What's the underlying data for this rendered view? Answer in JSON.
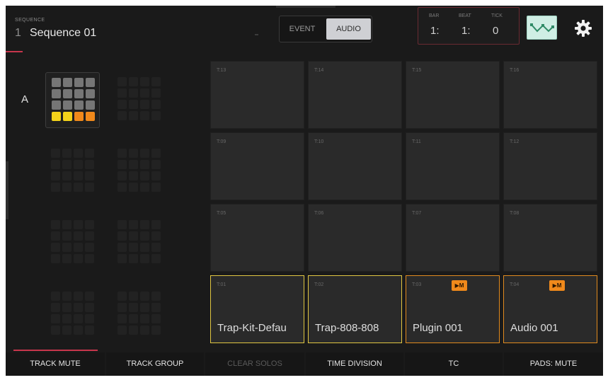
{
  "header": {
    "sequence_label": "SEQUENCE",
    "sequence_number": "1",
    "sequence_name": "Sequence 01",
    "mode_event": "EVENT",
    "mode_audio": "AUDIO",
    "selected_mode": "AUDIO",
    "counter": {
      "bar_label": "BAR",
      "beat_label": "BEAT",
      "tick_label": "TICK",
      "bar_value": "1:",
      "beat_value": "1:",
      "tick_value": "0"
    },
    "automation_icon": "automation-curve-icon",
    "settings_icon": "gear-icon"
  },
  "left_panel": {
    "bank_label": "A",
    "pad_colors": {
      "gray": "#767676",
      "yellow": "#f3d21a",
      "orange": "#f0891b"
    }
  },
  "pads": [
    {
      "num": "T:13",
      "name": ""
    },
    {
      "num": "T:14",
      "name": ""
    },
    {
      "num": "T:15",
      "name": ""
    },
    {
      "num": "T:16",
      "name": ""
    },
    {
      "num": "T:09",
      "name": ""
    },
    {
      "num": "T:10",
      "name": ""
    },
    {
      "num": "T:11",
      "name": ""
    },
    {
      "num": "T:12",
      "name": ""
    },
    {
      "num": "T:05",
      "name": ""
    },
    {
      "num": "T:06",
      "name": ""
    },
    {
      "num": "T:07",
      "name": ""
    },
    {
      "num": "T:08",
      "name": ""
    },
    {
      "num": "T:01",
      "name": "Trap-Kit-Defau"
    },
    {
      "num": "T:02",
      "name": "Trap-808-808"
    },
    {
      "num": "T:03",
      "name": "Plugin 001",
      "badge": "▶M"
    },
    {
      "num": "T:04",
      "name": "Audio 001",
      "badge": "▶M"
    }
  ],
  "colors": {
    "accent_red": "#c7364c",
    "selected_yellow": "#e0c642",
    "track_orange": "#e08a1e"
  },
  "bottom_bar": [
    {
      "label": "TRACK MUTE",
      "active": true
    },
    {
      "label": "TRACK GROUP",
      "active": false
    },
    {
      "label": "CLEAR SOLOS",
      "disabled": true
    },
    {
      "label": "TIME DIVISION",
      "active": false
    },
    {
      "label": "TC",
      "active": false
    },
    {
      "label": "PADS: MUTE",
      "active": false
    }
  ]
}
